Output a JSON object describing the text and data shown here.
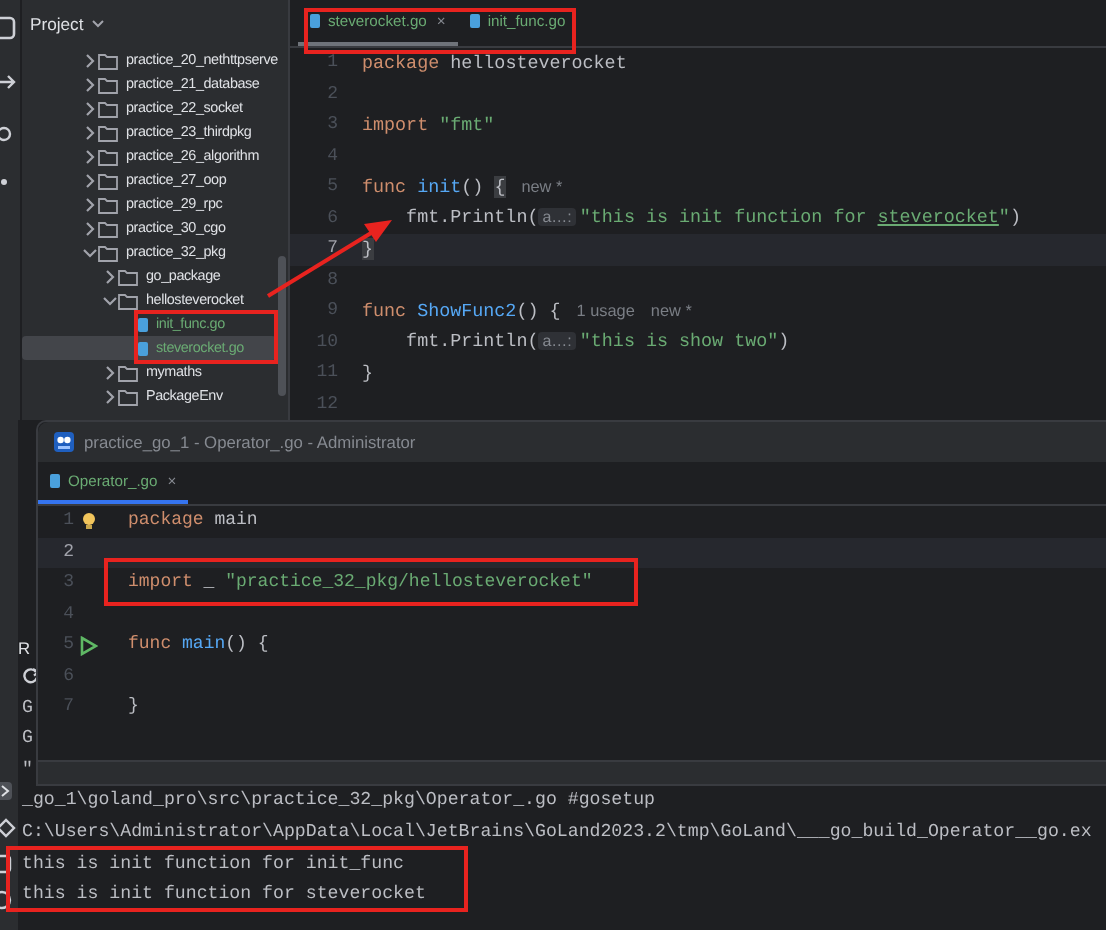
{
  "project": {
    "title": "Project",
    "tree": [
      {
        "name": "practice_20_nethttpserve",
        "kind": "folder",
        "expanded": false,
        "selected": false
      },
      {
        "name": "practice_21_database",
        "kind": "folder",
        "expanded": false,
        "selected": false
      },
      {
        "name": "practice_22_socket",
        "kind": "folder",
        "expanded": false,
        "selected": false
      },
      {
        "name": "practice_23_thirdpkg",
        "kind": "folder",
        "expanded": false,
        "selected": false
      },
      {
        "name": "practice_26_algorithm",
        "kind": "folder",
        "expanded": false,
        "selected": false
      },
      {
        "name": "practice_27_oop",
        "kind": "folder",
        "expanded": false,
        "selected": false
      },
      {
        "name": "practice_29_rpc",
        "kind": "folder",
        "expanded": false,
        "selected": false
      },
      {
        "name": "practice_30_cgo",
        "kind": "folder",
        "expanded": false,
        "selected": false
      },
      {
        "name": "practice_32_pkg",
        "kind": "folder",
        "expanded": true,
        "selected": false,
        "children": [
          {
            "name": "go_package",
            "kind": "folder",
            "expanded": false,
            "selected": false
          },
          {
            "name": "hellosteverocket",
            "kind": "folder",
            "expanded": true,
            "selected": false,
            "children": [
              {
                "name": "init_func.go",
                "kind": "file",
                "selected": false
              },
              {
                "name": "steverocket.go",
                "kind": "file",
                "selected": true
              }
            ]
          },
          {
            "name": "mymaths",
            "kind": "folder",
            "expanded": false,
            "selected": false
          },
          {
            "name": "PackageEnv",
            "kind": "folder",
            "expanded": false,
            "selected": false
          }
        ]
      }
    ]
  },
  "editor": {
    "tabs": [
      {
        "label": "steverocket.go",
        "selected": true,
        "close": "×"
      },
      {
        "label": "init_func.go",
        "selected": false
      }
    ],
    "lines": [
      {
        "number": "1",
        "current": false,
        "tokens": [
          {
            "kind": "keyword",
            "text": "package"
          },
          {
            "kind": "plain",
            "text": " hellosteverocket"
          }
        ]
      },
      {
        "number": "2",
        "current": false
      },
      {
        "number": "3",
        "current": false,
        "tokens": [
          {
            "kind": "keyword",
            "text": "import "
          },
          {
            "kind": "string",
            "text": "\"fmt\""
          }
        ]
      },
      {
        "number": "4",
        "current": false
      },
      {
        "number": "5",
        "current": false,
        "tokens": [
          {
            "kind": "keyword",
            "text": "func "
          },
          {
            "kind": "function",
            "text": "init"
          },
          {
            "kind": "plain",
            "text": "() "
          },
          {
            "kind": "brace",
            "text": "{"
          },
          {
            "kind": "hint",
            "text": "new *"
          }
        ]
      },
      {
        "number": "6",
        "current": false,
        "tokens": [
          {
            "kind": "plain",
            "text": "    fmt.Println("
          },
          {
            "kind": "inlay",
            "text": "a…:"
          },
          {
            "kind": "string",
            "text": "\"this is init function for "
          },
          {
            "kind": "typo",
            "text": "steverocket"
          },
          {
            "kind": "string",
            "text": "\""
          },
          {
            "kind": "plain",
            "text": ")"
          }
        ]
      },
      {
        "number": "7",
        "current": true,
        "tokens": [
          {
            "kind": "brace",
            "text": "}"
          }
        ]
      },
      {
        "number": "8",
        "current": false
      },
      {
        "number": "9",
        "current": false,
        "tokens": [
          {
            "kind": "keyword",
            "text": "func "
          },
          {
            "kind": "function",
            "text": "ShowFunc2"
          },
          {
            "kind": "plain",
            "text": "() {"
          },
          {
            "kind": "hint",
            "text": "1 usage"
          },
          {
            "kind": "hint",
            "text": "new *"
          }
        ]
      },
      {
        "number": "10",
        "current": false,
        "tokens": [
          {
            "kind": "plain",
            "text": "    fmt.Println("
          },
          {
            "kind": "inlay",
            "text": "a…:"
          },
          {
            "kind": "string",
            "text": "\"this is show two\""
          },
          {
            "kind": "plain",
            "text": ")"
          }
        ]
      },
      {
        "number": "11",
        "current": false,
        "tokens": [
          {
            "kind": "plain",
            "text": "}"
          }
        ]
      },
      {
        "number": "12",
        "current": false
      }
    ]
  },
  "run_panel": {
    "title": "R",
    "lines": [
      "G",
      "G",
      "\"",
      "_go_1\\goland_pro\\src\\practice_32_pkg\\Operator_.go #gosetup",
      "C:\\Users\\Administrator\\AppData\\Local\\JetBrains\\GoLand2023.2\\tmp\\GoLand\\___go_build_Operator__go.ex",
      "this is init function for init_func",
      "this is init function for steverocket"
    ]
  },
  "window": {
    "title": "practice_go_1 - Operator_.go - Administrator",
    "tabs": [
      {
        "label": "Operator_.go",
        "selected": true,
        "close": "×"
      }
    ],
    "lines": [
      {
        "number": "1",
        "current": false,
        "kind": "bulb",
        "tokens": [
          {
            "kind": "keyword",
            "text": "package"
          },
          {
            "kind": "plain",
            "text": " main"
          }
        ]
      },
      {
        "number": "2",
        "current": true,
        "kind": "plain"
      },
      {
        "number": "3",
        "current": false,
        "kind": "plain",
        "tokens": [
          {
            "kind": "keyword",
            "text": "import"
          },
          {
            "kind": "plain",
            "text": " _ "
          },
          {
            "kind": "string",
            "text": "\"practice_32_pkg/hellosteverocket\""
          }
        ]
      },
      {
        "number": "4",
        "current": false,
        "kind": "plain"
      },
      {
        "number": "5",
        "current": false,
        "kind": "run",
        "tokens": [
          {
            "kind": "keyword",
            "text": "func "
          },
          {
            "kind": "function",
            "text": "main"
          },
          {
            "kind": "plain",
            "text": "() {"
          }
        ]
      },
      {
        "number": "6",
        "current": false,
        "kind": "plain"
      },
      {
        "number": "7",
        "current": false,
        "kind": "plain",
        "tokens": [
          {
            "kind": "plain",
            "text": "}"
          }
        ]
      }
    ]
  }
}
